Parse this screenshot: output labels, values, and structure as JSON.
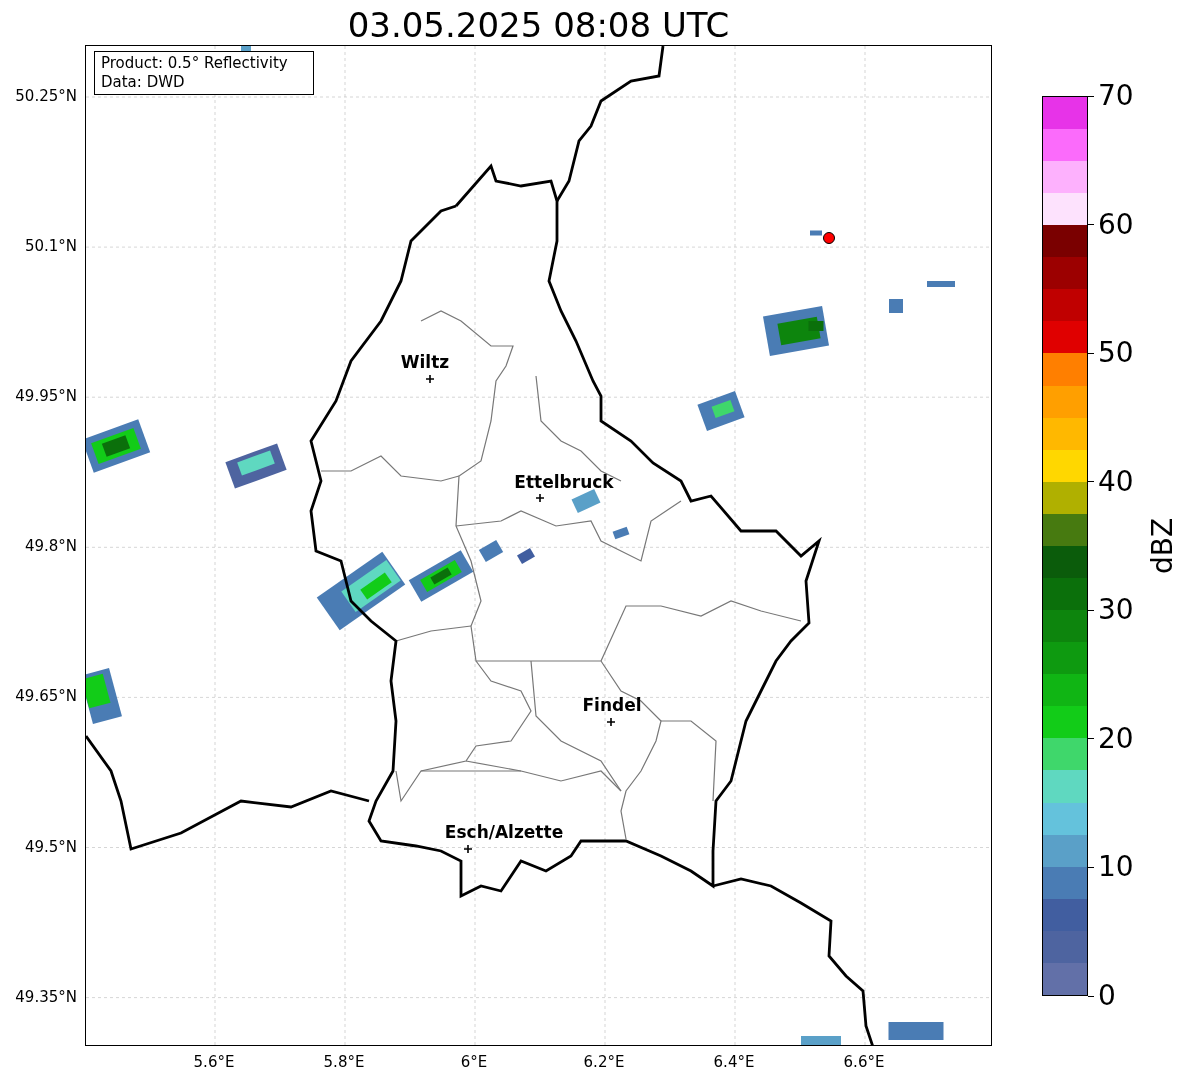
{
  "title": "03.05.2025 08:08 UTC",
  "info_box": {
    "lines": [
      "Product: 0.5° Reflectivity",
      "Data: DWD"
    ]
  },
  "map": {
    "y_ticks": [
      "50.25°N",
      "50.1°N",
      "49.95°N",
      "49.8°N",
      "49.65°N",
      "49.5°N",
      "49.35°N"
    ],
    "x_ticks": [
      "5.6°E",
      "5.8°E",
      "6°E",
      "6.2°E",
      "6.4°E",
      "6.6°E"
    ],
    "places": [
      {
        "name": "Wiltz"
      },
      {
        "name": "Ettelbruck"
      },
      {
        "name": "Findel"
      },
      {
        "name": "Esch/Alzette"
      }
    ]
  },
  "colorbar": {
    "label": "dBZ",
    "ticks": [
      "70",
      "60",
      "50",
      "40",
      "30",
      "20",
      "10",
      "0"
    ],
    "bands": [
      {
        "color": "#6270a8"
      },
      {
        "color": "#4e64a0"
      },
      {
        "color": "#415ea0"
      },
      {
        "color": "#4a7cb4"
      },
      {
        "color": "#5aa0c8"
      },
      {
        "color": "#64c2dc"
      },
      {
        "color": "#5fd8c0"
      },
      {
        "color": "#3fd76b"
      },
      {
        "color": "#12cc18"
      },
      {
        "color": "#10b514"
      },
      {
        "color": "#0e9a10"
      },
      {
        "color": "#0d850d"
      },
      {
        "color": "#0b700b"
      },
      {
        "color": "#0b5c0b"
      },
      {
        "color": "#477a10"
      },
      {
        "color": "#b0b000"
      },
      {
        "color": "#ffd700"
      },
      {
        "color": "#ffb800"
      },
      {
        "color": "#ff9f00"
      },
      {
        "color": "#ff7f00"
      },
      {
        "color": "#e00000"
      },
      {
        "color": "#c00000"
      },
      {
        "color": "#9c0000"
      },
      {
        "color": "#7a0000"
      },
      {
        "color": "#fde2fd"
      },
      {
        "color": "#fdb1fd"
      },
      {
        "color": "#fb6bfb"
      },
      {
        "color": "#e733e8"
      }
    ]
  }
}
